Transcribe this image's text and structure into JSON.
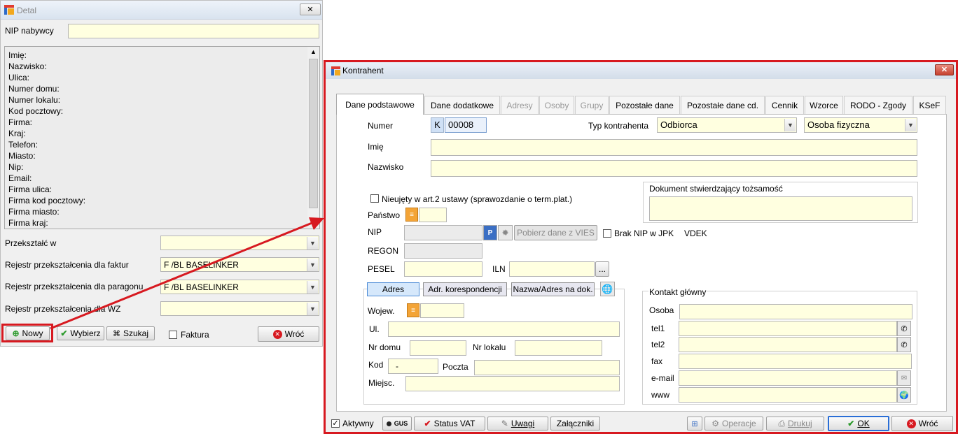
{
  "detal": {
    "title": "Detal",
    "nip_label": "NIP nabywcy",
    "nip_value": "",
    "info_lines": [
      "Imię:",
      "Nazwisko:",
      "Ulica:",
      "Numer domu:",
      "Numer lokalu:",
      "Kod pocztowy:",
      "Firma:",
      "Kraj:",
      "Telefon:",
      "Miasto:",
      "Nip:",
      "Email:",
      "Firma ulica:",
      "Firma kod pocztowy:",
      "Firma miasto:",
      "Firma kraj:"
    ],
    "przeksztalc_label": "Przekształć w",
    "przeksztalc_value": "",
    "rejestr_faktur_label": "Rejestr przekształcenia dla faktur",
    "rejestr_faktur_value": "F /BL BASELINKER",
    "rejestr_paragonu_label": "Rejestr przekształcenia dla paragonu",
    "rejestr_paragonu_value": "F /BL BASELINKER",
    "rejestr_wz_label": "Rejestr przekształcenia dla WZ",
    "rejestr_wz_value": "",
    "buttons": {
      "nowy": "Nowy",
      "wybierz": "Wybierz",
      "szukaj": "Szukaj",
      "wroc": "Wróć"
    },
    "faktura_label": "Faktura"
  },
  "kontrahent": {
    "title": "Kontrahent",
    "tabs": [
      {
        "label": "Dane podstawowe",
        "state": "active"
      },
      {
        "label": "Dane dodatkowe",
        "state": "normal"
      },
      {
        "label": "Adresy",
        "state": "disabled"
      },
      {
        "label": "Osoby",
        "state": "disabled"
      },
      {
        "label": "Grupy",
        "state": "disabled"
      },
      {
        "label": "Pozostałe dane",
        "state": "normal"
      },
      {
        "label": "Pozostałe dane cd.",
        "state": "normal"
      },
      {
        "label": "Cennik",
        "state": "normal"
      },
      {
        "label": "Wzorce",
        "state": "normal"
      },
      {
        "label": "RODO - Zgody",
        "state": "normal"
      },
      {
        "label": "KSeF",
        "state": "normal"
      }
    ],
    "numer_label": "Numer",
    "numer_prefix": "K",
    "numer_value": "00008",
    "typ_label": "Typ kontrahenta",
    "typ_value": "Odbiorca",
    "osoba_value": "Osoba fizyczna",
    "imie_label": "Imię",
    "nazwisko_label": "Nazwisko",
    "nieujety_label": "Nieujęty w art.2 ustawy (sprawozdanie o term.plat.)",
    "dokument_label": "Dokument stwierdzający tożsamość",
    "panstwo_label": "Państwo",
    "nip_label": "NIP",
    "vies_button": "Pobierz dane z VIES",
    "brak_nip_label": "Brak NIP w JPK",
    "vdek_label": "VDEK",
    "regon_label": "REGON",
    "pesel_label": "PESEL",
    "iln_label": "ILN",
    "iln_button": "...",
    "addr_tabs": {
      "adres": "Adres",
      "korespondencja": "Adr. korespondencji",
      "nazwa": "Nazwa/Adres na dok."
    },
    "wojew_label": "Wojew.",
    "ul_label": "Ul.",
    "nr_domu_label": "Nr domu",
    "nr_lokalu_label": "Nr lokalu",
    "kod_label": "Kod",
    "kod_value": "-",
    "poczta_label": "Poczta",
    "miejsc_label": "Miejsc.",
    "kontakt_label": "Kontakt główny",
    "osoba_label": "Osoba",
    "tel1_label": "tel1",
    "tel2_label": "tel2",
    "fax_label": "fax",
    "email_label": "e-mail",
    "www_label": "www",
    "aktywny_label": "Aktywny",
    "gus_label": "GUS",
    "status_vat": "Status VAT",
    "uwagi": "Uwagi",
    "zalaczniki": "Załączniki",
    "operacje": "Operacje",
    "drukuj": "Drukuj",
    "ok": "OK",
    "wroc": "Wróć"
  },
  "colors": {
    "accent_red": "#d71920",
    "field_yellow": "#ffffe0",
    "ok_border": "#2a6ed6"
  }
}
